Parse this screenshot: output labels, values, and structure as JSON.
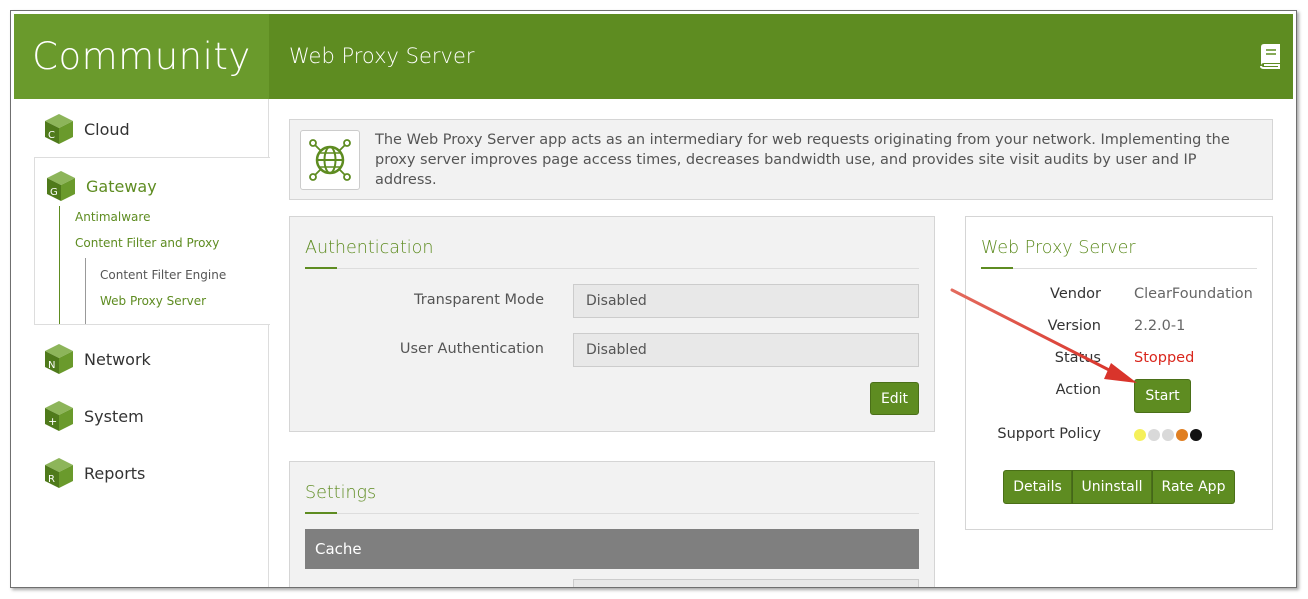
{
  "brand": {
    "label": "Community"
  },
  "header": {
    "title": "Web Proxy Server",
    "help_icon": "book-icon"
  },
  "sidebar": {
    "items": [
      {
        "letter": "C",
        "label": "Cloud"
      },
      {
        "letter": "G",
        "label": "Gateway"
      },
      {
        "letter": "N",
        "label": "Network"
      },
      {
        "letter": "+",
        "label": "System"
      },
      {
        "letter": "R",
        "label": "Reports"
      }
    ],
    "gateway_sub": {
      "antimalware": "Antimalware",
      "content_filter_proxy": "Content Filter and Proxy",
      "content_filter_engine": "Content Filter Engine",
      "web_proxy_server": "Web Proxy Server"
    }
  },
  "intro": {
    "icon": "globe-icon",
    "text": "The Web Proxy Server app acts as an intermediary for web requests originating from your network. Implementing the proxy server improves page access times, decreases bandwidth use, and provides site visit audits by user and IP address."
  },
  "authentication": {
    "title": "Authentication",
    "transparent_mode_label": "Transparent Mode",
    "transparent_mode_value": "Disabled",
    "user_auth_label": "User Authentication",
    "user_auth_value": "Disabled",
    "edit_label": "Edit"
  },
  "settings": {
    "title": "Settings",
    "cache_label": "Cache"
  },
  "app_info": {
    "title": "Web Proxy Server",
    "vendor_label": "Vendor",
    "vendor_value": "ClearFoundation",
    "version_label": "Version",
    "version_value": "2.2.0-1",
    "status_label": "Status",
    "status_value": "Stopped",
    "action_label": "Action",
    "start_label": "Start",
    "support_label": "Support Policy",
    "support_dots": [
      "#f5f05a",
      "#d9d9d9",
      "#d9d9d9",
      "#e07f22",
      "#111111"
    ],
    "details_label": "Details",
    "uninstall_label": "Uninstall",
    "rate_label": "Rate App"
  },
  "colors": {
    "accent": "#5e8c21",
    "brand": "#6a9a2c",
    "status_stopped": "#d9261c",
    "arrow": "#d9342b"
  }
}
